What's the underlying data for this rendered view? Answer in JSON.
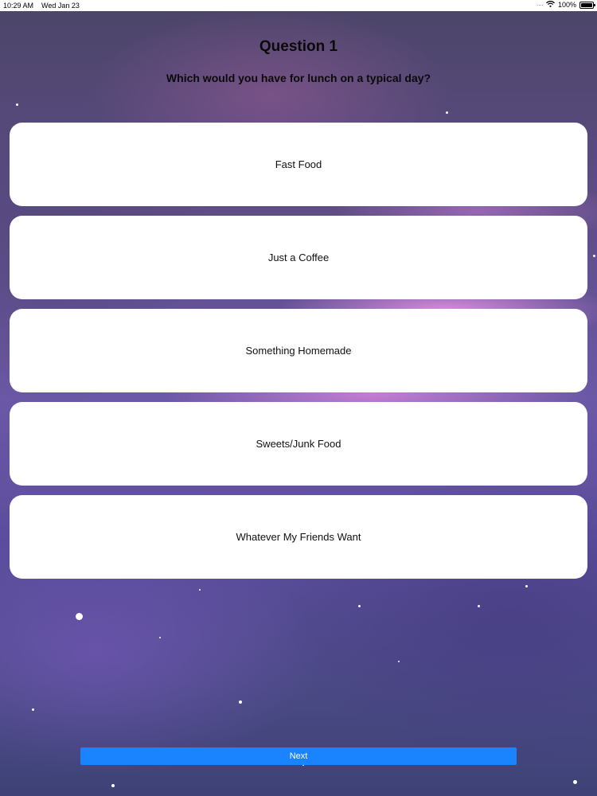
{
  "status_bar": {
    "time": "10:29 AM",
    "date": "Wed Jan 23",
    "battery": "100%",
    "wifi_icon": "wifi-icon",
    "battery_icon": "battery-icon"
  },
  "quiz": {
    "title": "Question 1",
    "question": "Which would you have for lunch on a typical day?",
    "options": [
      {
        "label": "Fast Food"
      },
      {
        "label": "Just a Coffee"
      },
      {
        "label": "Something Homemade"
      },
      {
        "label": "Sweets/Junk Food"
      },
      {
        "label": "Whatever My Friends Want"
      }
    ],
    "next_label": "Next"
  },
  "colors": {
    "accent": "#1a84ff",
    "card": "#ffffff",
    "background": "#5d4c84"
  }
}
